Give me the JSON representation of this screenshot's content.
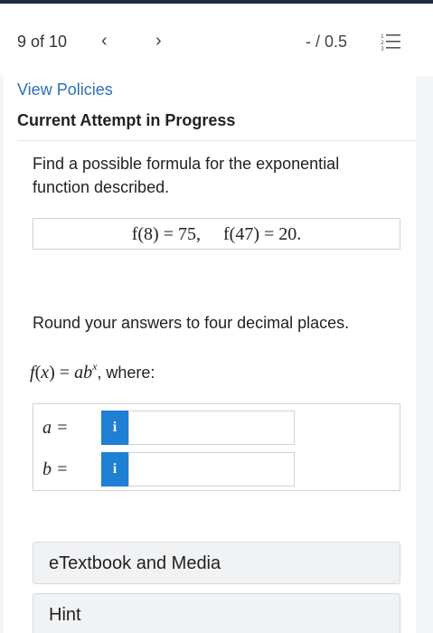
{
  "nav": {
    "question_count": "9 of 10",
    "prev_icon": "‹",
    "next_icon": "›",
    "score": "- / 0.5",
    "list_icon": "numbered-list-icon"
  },
  "header": {
    "view_policies": "View Policies",
    "attempt_title": "Current Attempt in Progress"
  },
  "question": {
    "prompt": "Find a possible formula for the exponential function described.",
    "given": "f(8) = 75,     f(47) = 20.",
    "instruction": "Round your answers to four decimal places.",
    "where": ", where:"
  },
  "answers": [
    {
      "label": "a =",
      "info": "i",
      "value": "",
      "placeholder": ""
    },
    {
      "label": "b =",
      "info": "i",
      "value": "",
      "placeholder": ""
    }
  ],
  "buttons": {
    "etextbook": "eTextbook and Media",
    "hint": "Hint"
  },
  "colors": {
    "top_bar": "#1d2a44",
    "link": "#2f6fb3",
    "info_button": "#1e7fd4"
  }
}
